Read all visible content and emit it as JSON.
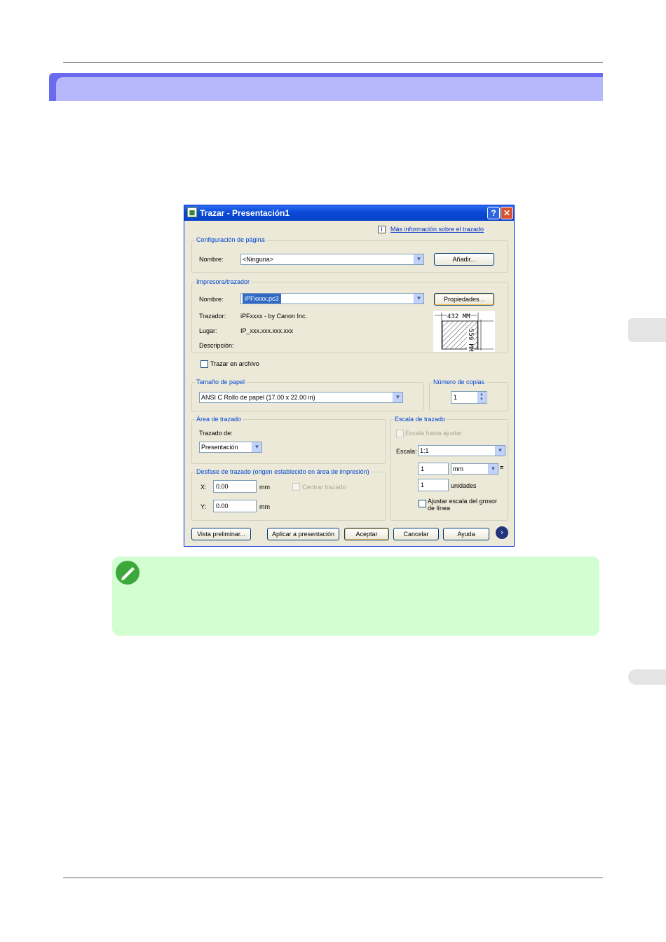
{
  "dialog": {
    "title": "Trazar - Presentación1",
    "help_button": "?",
    "close_button": "✕",
    "info_link": "Más información sobre el trazado",
    "page_setup": {
      "group": "Configuración de página",
      "name_label": "Nombre:",
      "name_value": "<Ninguna>",
      "add_button": "Añadir..."
    },
    "printer": {
      "group": "Impresora/trazador",
      "name_label": "Nombre:",
      "name_value": "iPFxxxx.pc3",
      "properties_button": "Propiedades...",
      "plotter_label": "Trazador:",
      "plotter_value": "iPFxxxx - by Canon Inc.",
      "location_label": "Lugar:",
      "location_value": "IP_xxx.xxx.xxx.xxx",
      "description_label": "Descripción:",
      "plot_to_file": "Trazar en archivo",
      "preview_width": "432 MM",
      "preview_height": "559 MM"
    },
    "paper_size": {
      "group": "Tamaño de papel",
      "value": "ANSI C Rollo de papel (17.00 x 22.00 in)"
    },
    "copies": {
      "group": "Número de copias",
      "value": "1"
    },
    "plot_area": {
      "group": "Área de trazado",
      "what_label": "Trazado de:",
      "what_value": "Presentación"
    },
    "plot_offset": {
      "group": "Desfase de trazado (origen establecido en área de impresión)",
      "x_label": "X:",
      "x_value": "0.00",
      "y_label": "Y:",
      "y_value": "0.00",
      "unit": "mm",
      "center_plot": "Centrar trazado"
    },
    "plot_scale": {
      "group": "Escala de trazado",
      "fit_to_paper": "Escala hasta ajustar",
      "scale_label": "Escala:",
      "scale_value": "1:1",
      "units_value": "1",
      "units_select": "mm",
      "equals": "=",
      "units2_value": "1",
      "units2_label": "unidades",
      "lineweights": "Ajustar escala del grosor de línea"
    },
    "buttons": {
      "preview": "Vista preliminar...",
      "apply": "Aplicar a presentación",
      "ok": "Aceptar",
      "cancel": "Cancelar",
      "help": "Ayuda",
      "more": "›"
    }
  },
  "colors": {
    "section_bar": "#b7b7fb",
    "section_bar_edge": "#6a6af0",
    "note_background": "#d2fed2",
    "xp_title_blue": "#0a4ad8"
  }
}
